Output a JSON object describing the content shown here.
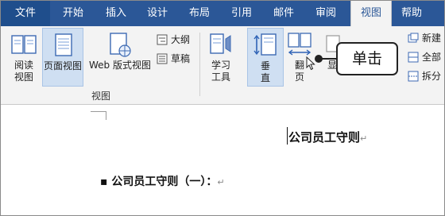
{
  "tabs": [
    {
      "label": "文件"
    },
    {
      "label": "开始"
    },
    {
      "label": "插入"
    },
    {
      "label": "设计"
    },
    {
      "label": "布局"
    },
    {
      "label": "引用"
    },
    {
      "label": "邮件"
    },
    {
      "label": "审阅"
    },
    {
      "label": "视图"
    },
    {
      "label": "帮助"
    }
  ],
  "ribbon": {
    "read_line1": "阅读",
    "read_line2": "视图",
    "print_layout": "页面视图",
    "web_layout": "Web 版式视图",
    "outline": "大纲",
    "draft": "草稿",
    "group_label": "视图",
    "learning_line1": "学习",
    "learning_line2": "工具",
    "vertical_line1": "垂",
    "vertical_line2": "直",
    "side_line1": "翻",
    "side_line2": "页",
    "partial_show": "显",
    "new_window": "新建",
    "arrange_all": "全部",
    "split": "拆分"
  },
  "callout": {
    "text": "单击"
  },
  "document": {
    "title": "公司员工守则",
    "heading": "▪ 公司员工守则（一）：",
    "para_mark": "↵"
  },
  "colors": {
    "tabbar": "#2b5797",
    "ribbon_bg": "#f3f3f3",
    "selected": "#cfdff2"
  }
}
